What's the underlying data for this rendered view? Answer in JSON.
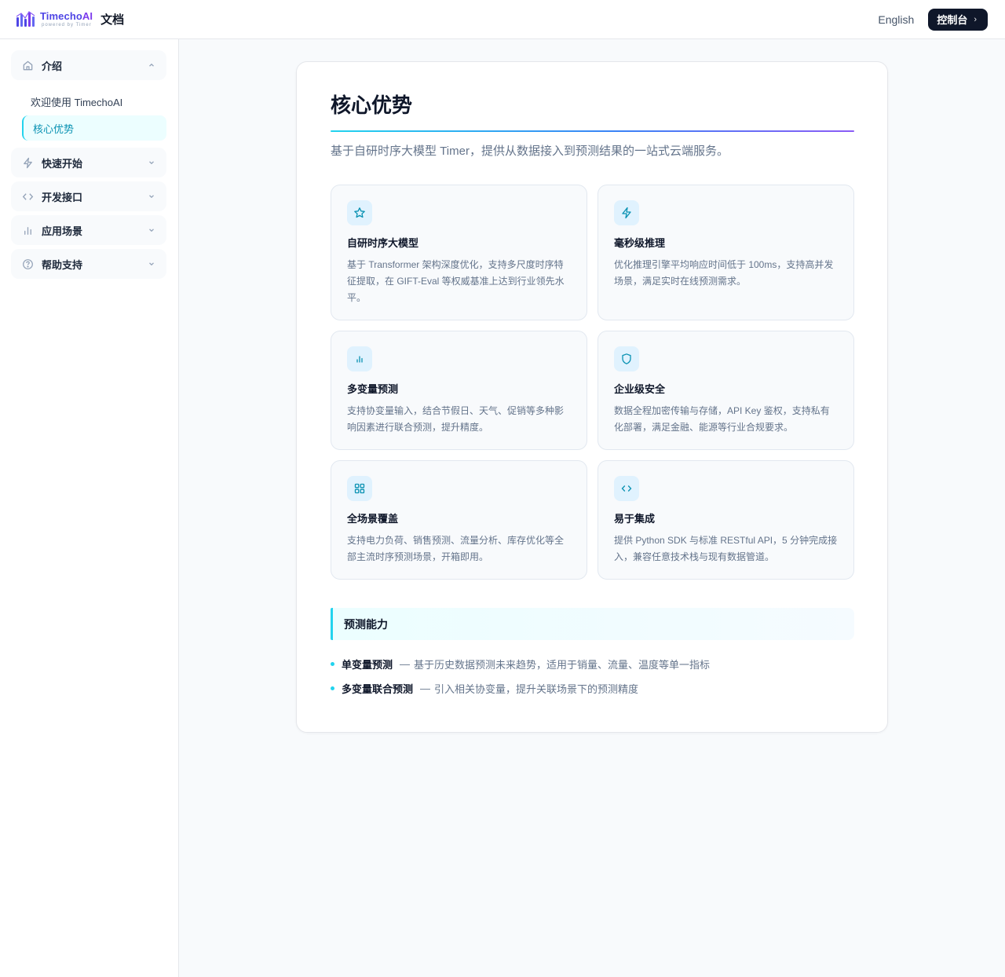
{
  "header": {
    "logo_name": "Timecho",
    "logo_name_ai": "AI",
    "logo_sub": "powered by Timer",
    "docs_label": "文档",
    "language_link": "English",
    "console_button": "控制台",
    "console_chevron": "›"
  },
  "sidebar": {
    "groups": [
      {
        "label": "介绍",
        "icon": "home-icon",
        "expanded": true,
        "items": [
          {
            "label": "欢迎使用 TimechoAI"
          },
          {
            "label": "核心优势",
            "active": true
          }
        ]
      },
      {
        "label": "快速开始",
        "icon": "lightning-icon",
        "expanded": false
      },
      {
        "label": "开发接口",
        "icon": "code-icon",
        "expanded": false
      },
      {
        "label": "应用场景",
        "icon": "bar-chart-icon",
        "expanded": false
      },
      {
        "label": "帮助支持",
        "icon": "help-circle-icon",
        "expanded": false
      }
    ]
  },
  "main": {
    "title": "核心优势",
    "description": "基于自研时序大模型 Timer，提供从数据接入到预测结果的一站式云端服务。",
    "features": [
      {
        "icon": "star-icon",
        "title": "自研时序大模型",
        "desc": "基于 Transformer 架构深度优化，支持多尺度时序特征提取，在 GIFT-Eval 等权威基准上达到行业领先水平。"
      },
      {
        "icon": "lightning-icon",
        "title": "毫秒级推理",
        "desc": "优化推理引擎平均响应时间低于 100ms，支持高并发场景，满足实时在线预测需求。"
      },
      {
        "icon": "bar-chart-icon",
        "title": "多变量预测",
        "desc": "支持协变量输入，结合节假日、天气、促销等多种影响因素进行联合预测，提升精度。"
      },
      {
        "icon": "shield-icon",
        "title": "企业级安全",
        "desc": "数据全程加密传输与存储，API Key 鉴权，支持私有化部署，满足金融、能源等行业合规要求。"
      },
      {
        "icon": "grid-icon",
        "title": "全场景覆盖",
        "desc": "支持电力负荷、销售预测、流量分析、库存优化等全部主流时序预测场景，开箱即用。"
      },
      {
        "icon": "code-icon",
        "title": "易于集成",
        "desc": "提供 Python SDK 与标准 RESTful API，5 分钟完成接入，兼容任意技术栈与现有数据管道。"
      }
    ],
    "section_title": "预测能力",
    "capabilities": [
      {
        "term": "单变量预测",
        "sep": "—",
        "desc": "基于历史数据预测未来趋势，适用于销量、流量、温度等单一指标"
      },
      {
        "term": "多变量联合预测",
        "sep": "—",
        "desc": "引入相关协变量，提升关联场景下的预测精度"
      }
    ]
  }
}
